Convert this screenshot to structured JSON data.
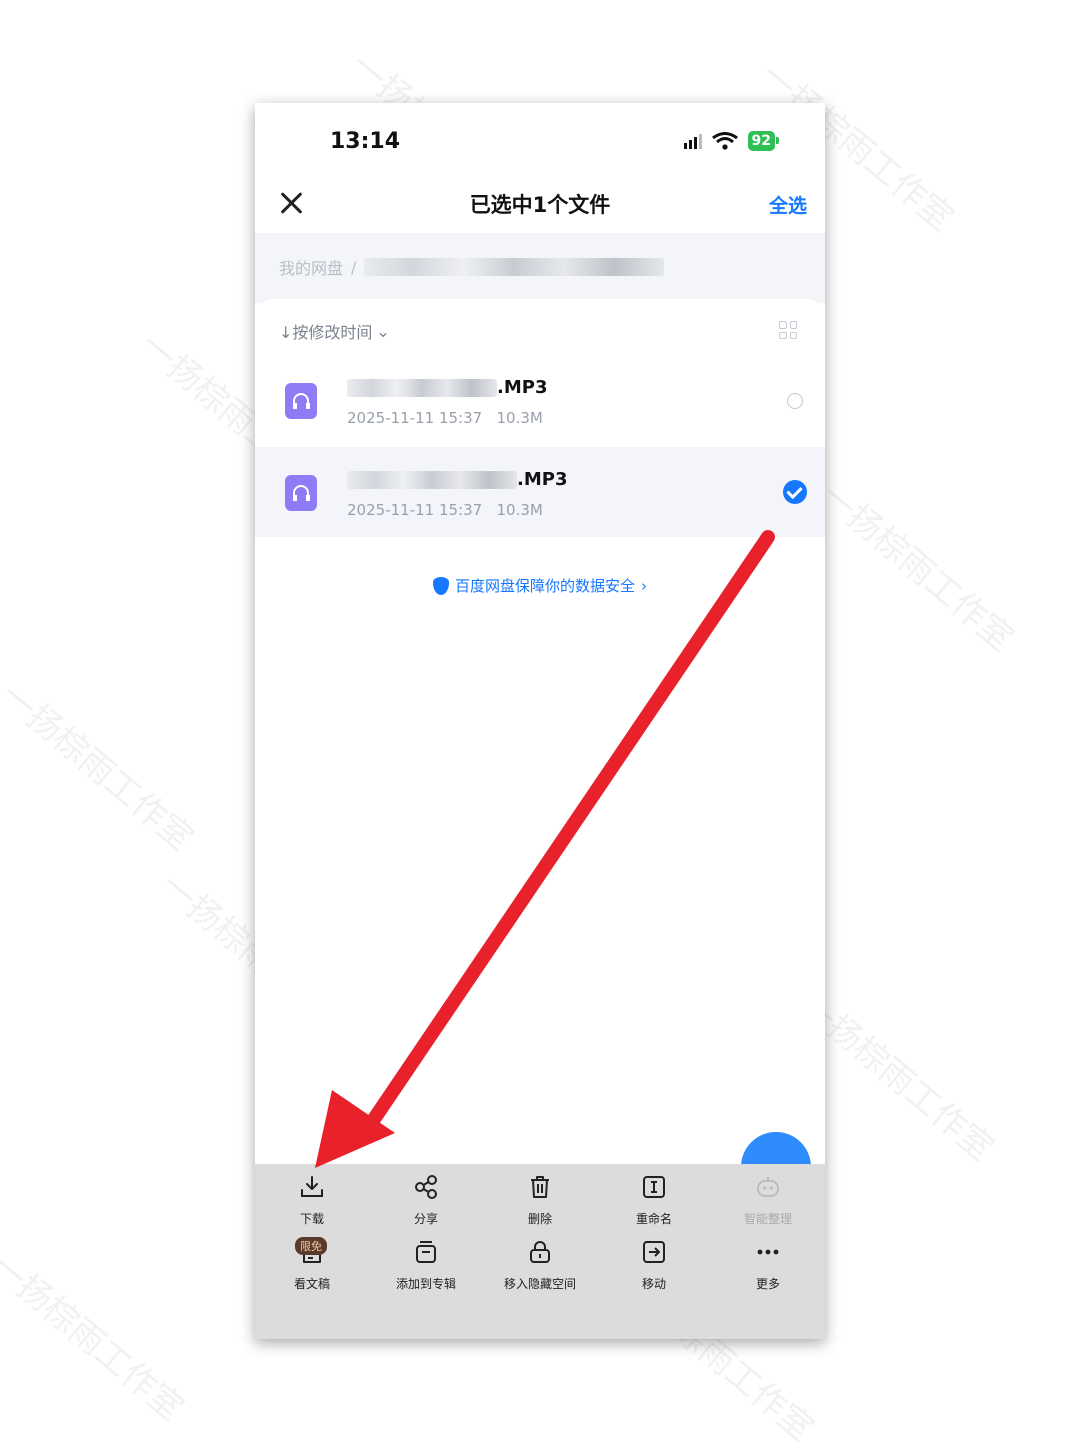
{
  "status_bar": {
    "time": "13:14",
    "battery": "92"
  },
  "header": {
    "title": "已选中1个文件",
    "select_all": "全选"
  },
  "breadcrumb": {
    "root": "我的网盘",
    "separator": "/"
  },
  "sort": {
    "label": "↓按修改时间",
    "chevron": "⌄"
  },
  "files": [
    {
      "name_suffix": ".MP3",
      "date": "2025-11-11 15:37",
      "size": "10.3M",
      "selected": false
    },
    {
      "name_suffix": ".MP3",
      "date": "2025-11-11 15:37",
      "size": "10.3M",
      "selected": true
    }
  ],
  "security_notice": {
    "text": "百度网盘保障你的数据安全",
    "chevron": "›"
  },
  "toolbar": {
    "row1": [
      {
        "label": "下载",
        "icon": "download-icon"
      },
      {
        "label": "分享",
        "icon": "share-icon"
      },
      {
        "label": "删除",
        "icon": "trash-icon"
      },
      {
        "label": "重命名",
        "icon": "rename-icon"
      },
      {
        "label": "智能整理",
        "icon": "robot-icon",
        "disabled": true
      }
    ],
    "row2": [
      {
        "label": "看文稿",
        "icon": "document-icon",
        "badge": "限免"
      },
      {
        "label": "添加到专辑",
        "icon": "album-icon"
      },
      {
        "label": "移入隐藏空间",
        "icon": "lock-icon"
      },
      {
        "label": "移动",
        "icon": "move-icon"
      },
      {
        "label": "更多",
        "icon": "more-icon"
      }
    ]
  },
  "watermark": "一扬棕雨工作室",
  "colors": {
    "accent": "#1677ff",
    "file_icon": "#8d7cf6",
    "arrow": "#e8212b",
    "battery": "#2fbf55"
  }
}
